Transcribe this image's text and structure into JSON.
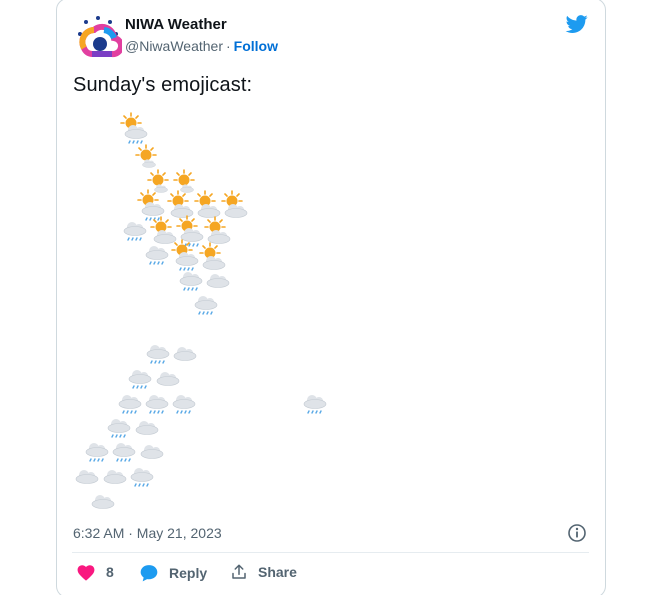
{
  "author": {
    "name": "NIWA Weather",
    "handle": "@NiwaWeather",
    "separator": "·",
    "follow_label": "Follow"
  },
  "tweet": {
    "text": "Sunday's emojicast:",
    "timestamp": "6:32 AM · May 21, 2023"
  },
  "actions": {
    "like_count": "8",
    "reply_label": "Reply",
    "share_label": "Share"
  },
  "colors": {
    "like": "#f91880",
    "reply": "#1d9bf0",
    "link": "#006fd6",
    "twitter_brand": "#1d9bf0",
    "sun": "#f5a623",
    "cloud": "#dfe3e8",
    "rain": "#5aa9e6"
  },
  "emojicast": {
    "north_island": [
      "sun-rain-cloud",
      "sun",
      "sun",
      "sun",
      "sun-rain-cloud",
      "sun-cloud",
      "sun-cloud",
      "sun-cloud",
      "rain-cloud",
      "sun-cloud",
      "sun-rain-cloud",
      "sun-cloud",
      "rain-cloud",
      "sun-rain-cloud",
      "sun-cloud",
      "rain-cloud",
      "cloud",
      "rain-cloud"
    ],
    "south_island": [
      "rain-cloud",
      "cloud",
      "rain-cloud",
      "cloud",
      "rain-cloud",
      "rain-cloud",
      "rain-cloud",
      "rain-cloud",
      "cloud",
      "rain-cloud",
      "rain-cloud",
      "cloud",
      "cloud",
      "cloud",
      "rain-cloud",
      "cloud"
    ],
    "chatham_islands": [
      "rain-cloud"
    ]
  }
}
